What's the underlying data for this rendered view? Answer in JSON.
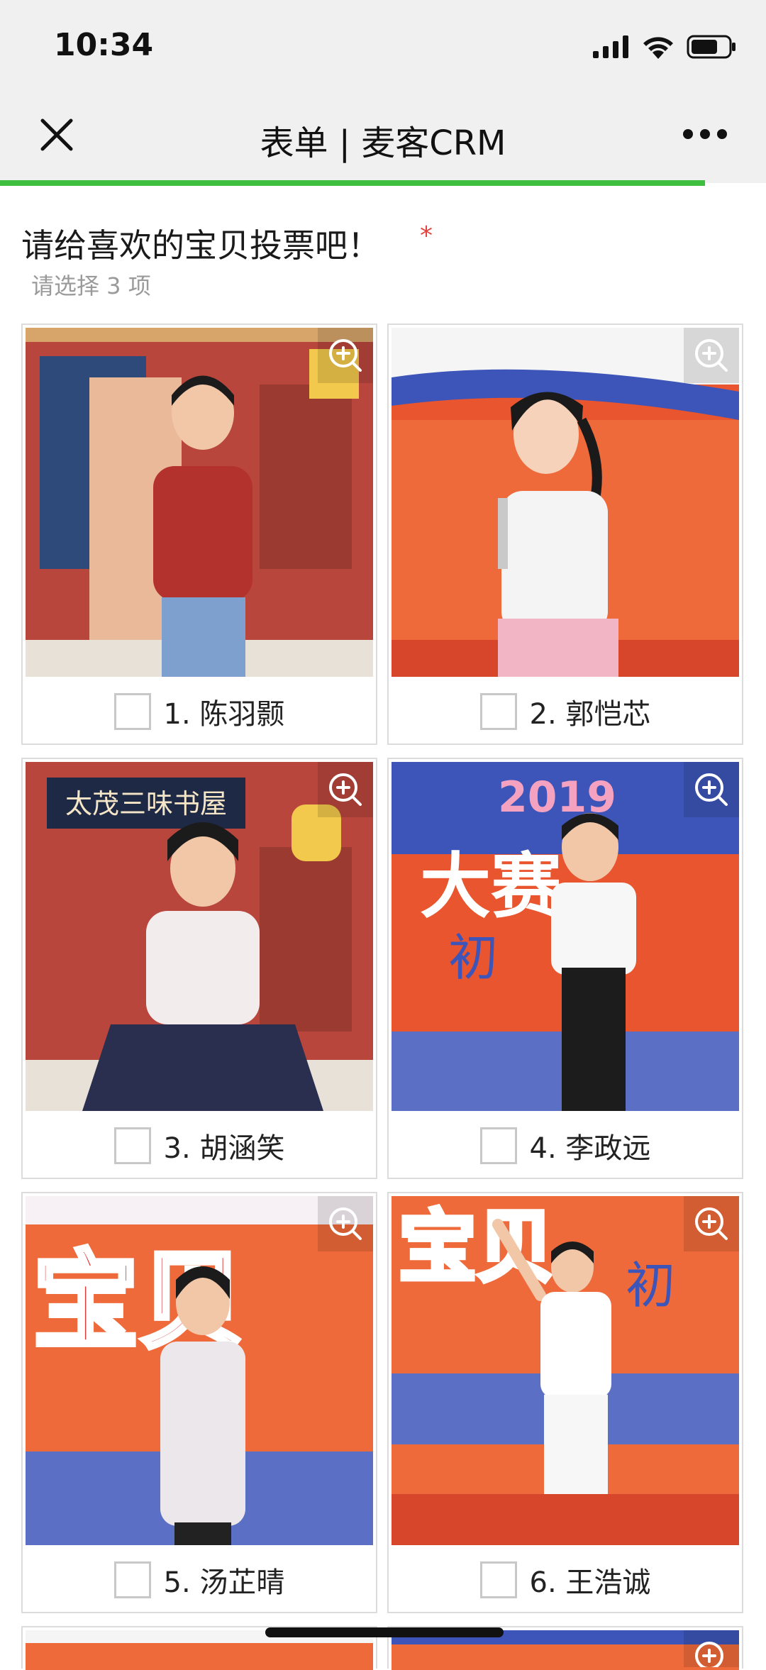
{
  "status": {
    "time": "10:34"
  },
  "nav": {
    "title": "表单 | 麦客CRM"
  },
  "form": {
    "question": "请给喜欢的宝贝投票吧！",
    "required_mark": "*",
    "hint": "请选择 3 项",
    "options": [
      {
        "label": "1. 陈羽颢"
      },
      {
        "label": "2. 郭恺芯"
      },
      {
        "label": "3. 胡涵笑"
      },
      {
        "label": "4. 李政远"
      },
      {
        "label": "5. 汤芷晴"
      },
      {
        "label": "6. 王浩诚"
      }
    ],
    "photo_captions": {
      "p3_sign": "太茂三味书屋",
      "p4_year": "2019",
      "p4_banner": "大赛",
      "p4_sub": "初",
      "p5_banner": "宝贝",
      "p6_banner": "宝贝",
      "p6_sub": "初"
    }
  },
  "colors": {
    "accent": "#3fbf3f",
    "required": "#e64340",
    "bar_bg": "#f0f0f0"
  }
}
